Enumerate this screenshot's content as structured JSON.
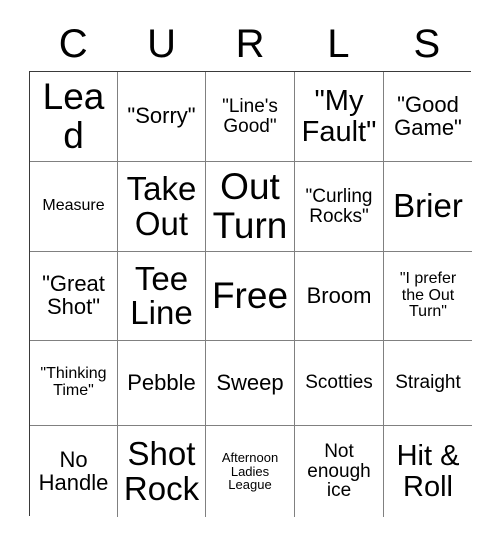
{
  "card": {
    "type": "bingo-card",
    "theme": "curling",
    "header_letters": [
      "C",
      "U",
      "R",
      "L",
      "S"
    ],
    "grid_size": "5x5",
    "free_space": "Free",
    "colors": {
      "background": "#ffffff",
      "text": "#000000",
      "inner_border": "#808080",
      "outer_border": "#3a3a3a"
    },
    "rows": [
      [
        {
          "text": "Lead",
          "size": "fs-xxl"
        },
        {
          "text": "\"Sorry\"",
          "size": "fs-md"
        },
        {
          "text": "\"Line's Good\"",
          "size": "fs-sm"
        },
        {
          "text": "\"My Fault\"",
          "size": "fs-lg"
        },
        {
          "text": "\"Good Game\"",
          "size": "fs-md"
        }
      ],
      [
        {
          "text": "Measure",
          "size": "fs-xs"
        },
        {
          "text": "Take Out",
          "size": "fs-xl"
        },
        {
          "text": "Out Turn",
          "size": "fs-xxl"
        },
        {
          "text": "\"Curling Rocks\"",
          "size": "fs-sm"
        },
        {
          "text": "Brier",
          "size": "fs-xl"
        }
      ],
      [
        {
          "text": "\"Great Shot\"",
          "size": "fs-md"
        },
        {
          "text": "Tee Line",
          "size": "fs-xl"
        },
        {
          "text": "Free",
          "size": "fs-xxl"
        },
        {
          "text": "Broom",
          "size": "fs-md"
        },
        {
          "text": "\"I prefer the Out Turn\"",
          "size": "fs-xs"
        }
      ],
      [
        {
          "text": "\"Thinking Time\"",
          "size": "fs-xs"
        },
        {
          "text": "Pebble",
          "size": "fs-md"
        },
        {
          "text": "Sweep",
          "size": "fs-md"
        },
        {
          "text": "Scotties",
          "size": "fs-sm"
        },
        {
          "text": "Straight",
          "size": "fs-sm"
        }
      ],
      [
        {
          "text": "No Handle",
          "size": "fs-md"
        },
        {
          "text": "Shot Rock",
          "size": "fs-xl"
        },
        {
          "text": "Afternoon Ladies League",
          "size": "fs-xxs"
        },
        {
          "text": "Not enough ice",
          "size": "fs-sm"
        },
        {
          "text": "Hit & Roll",
          "size": "fs-lg"
        }
      ]
    ]
  }
}
